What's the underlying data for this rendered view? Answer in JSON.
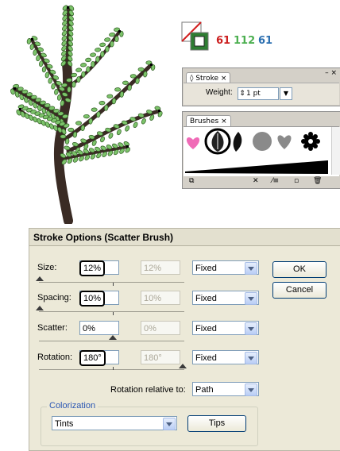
{
  "colors": {
    "fill_green": "#2e7d32",
    "red": "#cc1f1f",
    "green": "#4caf50",
    "blue": "#2c6fb0",
    "leaf": "#7cc36a",
    "trunk": "#3a2b24"
  },
  "swatch_numbers": {
    "red": "61",
    "green": "112",
    "blue": "61"
  },
  "stroke_panel": {
    "tab_label": "Stroke",
    "weight_label": "Weight:",
    "weight_value": "1 pt"
  },
  "brushes_panel": {
    "tab_label": "Brushes",
    "brushes": [
      "heart-brush",
      "leaf-brush",
      "leaf-dark-brush",
      "circle-brush",
      "heart-gray-brush",
      "flower-brush"
    ]
  },
  "dialog": {
    "title": "Stroke Options (Scatter Brush)",
    "rows": [
      {
        "label": "Size:",
        "value": "12%",
        "value2": "12%",
        "method": "Fixed"
      },
      {
        "label": "Spacing:",
        "value": "10%",
        "value2": "10%",
        "method": "Fixed"
      },
      {
        "label": "Scatter:",
        "value": "0%",
        "value2": "0%",
        "method": "Fixed"
      },
      {
        "label": "Rotation:",
        "value": "180°",
        "value2": "180°",
        "method": "Fixed"
      }
    ],
    "rotation_relative_label": "Rotation relative to:",
    "rotation_relative_value": "Path",
    "ok_label": "OK",
    "cancel_label": "Cancel",
    "colorization": {
      "legend": "Colorization",
      "method": "Tints",
      "tips_label": "Tips"
    }
  }
}
